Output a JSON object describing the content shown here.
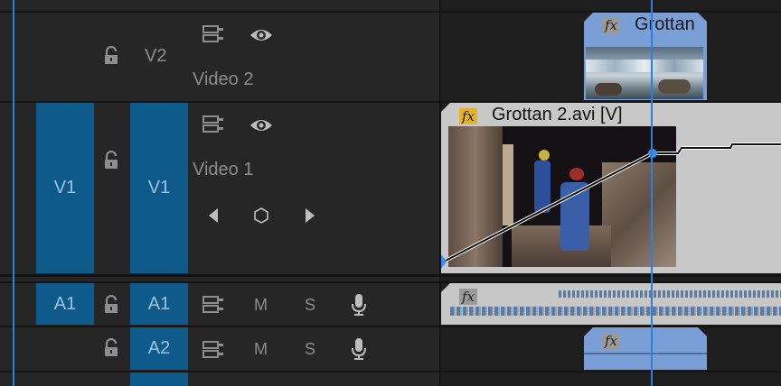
{
  "tracks": {
    "v2": {
      "target": "V2",
      "name": "Video 2"
    },
    "v1": {
      "source": "V1",
      "target": "V1",
      "name": "Video 1"
    },
    "a1": {
      "source": "A1",
      "target": "A1",
      "mute": "M",
      "solo": "S"
    },
    "a2": {
      "target": "A2",
      "mute": "M",
      "solo": "S"
    }
  },
  "clips": {
    "v2_clip": {
      "title": "Grottan",
      "fx": "fx"
    },
    "v1_clip": {
      "title": "Grottan 2.avi [V]",
      "fx": "fx"
    },
    "a1_clip": {
      "fx": "fx"
    },
    "a2_clip": {
      "fx": "fx"
    }
  },
  "colors": {
    "target_blue": "#0e5a8a",
    "clip_blue": "#7a9fd6",
    "clip_grey": "#c7c7c7",
    "playhead": "#2f7fd8",
    "fx_yellow": "#e5b32a"
  },
  "icons": {
    "lock": "lock-icon",
    "sync": "track-output-icon",
    "eye": "eye-icon",
    "mic": "microphone-icon",
    "prev_keyframe": "prev-keyframe-icon",
    "add_keyframe": "add-keyframe-icon",
    "next_keyframe": "next-keyframe-icon"
  }
}
